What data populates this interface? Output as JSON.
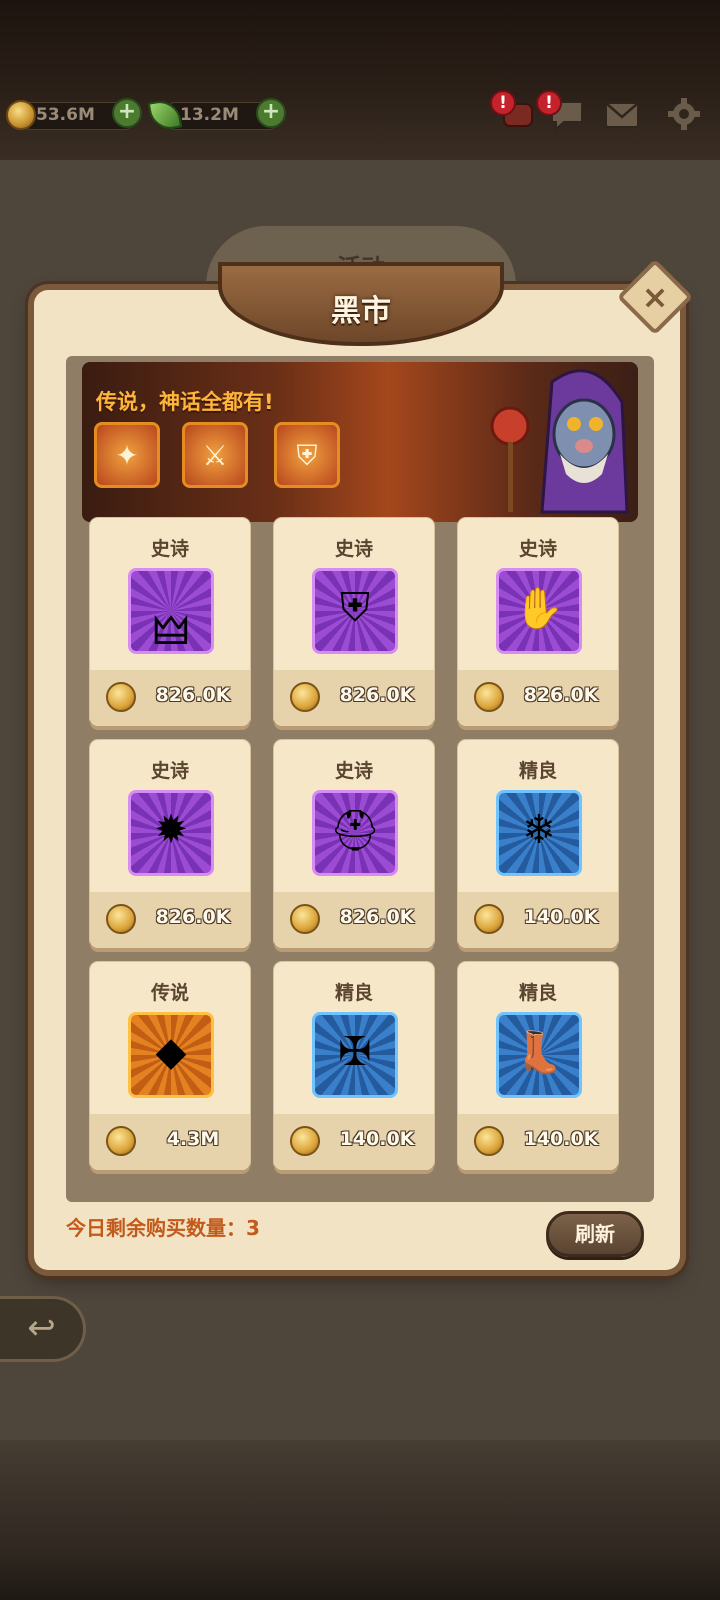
{
  "resources": [
    {
      "icon": "gold-coin-icon",
      "value": "53.6M"
    },
    {
      "icon": "green-leaf-icon",
      "value": "13.2M"
    }
  ],
  "top_icons": [
    "quest-scroll-icon",
    "chat-icon",
    "mail-icon",
    "gear-icon"
  ],
  "alerts": [
    "!",
    "!"
  ],
  "background_tab": "活动",
  "dialog": {
    "title": "黑市",
    "banner_headline": "传说，神话全都有!",
    "banner_items": [
      "scepter-icon",
      "axe-icon",
      "armor-icon"
    ],
    "items": [
      {
        "rarity": "史诗",
        "icon": "claw-icon",
        "price": "826.0K",
        "frame": "purple"
      },
      {
        "rarity": "史诗",
        "icon": "shoulder-armor-icon",
        "price": "826.0K",
        "frame": "purple"
      },
      {
        "rarity": "史诗",
        "icon": "gauntlet-icon",
        "price": "826.0K",
        "frame": "purple"
      },
      {
        "rarity": "史诗",
        "icon": "ruby-staff-icon",
        "price": "826.0K",
        "frame": "purple"
      },
      {
        "rarity": "史诗",
        "icon": "helmet-icon",
        "price": "826.0K",
        "frame": "purple"
      },
      {
        "rarity": "精良",
        "icon": "fur-cloak-icon",
        "price": "140.0K",
        "frame": "blue"
      },
      {
        "rarity": "传说",
        "icon": "gem-ring-icon",
        "price": "4.3M",
        "frame": "orange"
      },
      {
        "rarity": "精良",
        "icon": "spell-book-icon",
        "price": "140.0K",
        "frame": "blue"
      },
      {
        "rarity": "精良",
        "icon": "boots-icon",
        "price": "140.0K",
        "frame": "blue"
      }
    ],
    "remaining_label": "今日剩余购买数量：",
    "remaining_count": "3",
    "refresh_label": "刷新",
    "close_label": "×"
  },
  "back_label": "↩",
  "colors": {
    "accent_orange": "#ffb43a",
    "remaining_text": "#c25a1b",
    "panel_bg": "#f2e3c4"
  }
}
